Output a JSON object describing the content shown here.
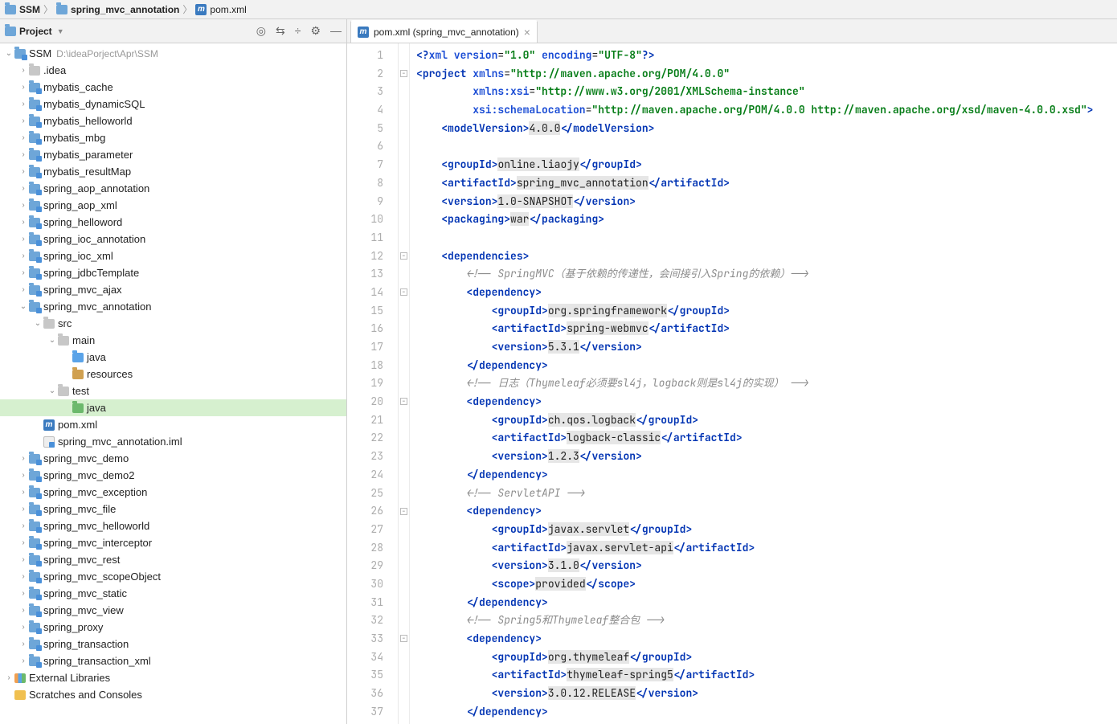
{
  "breadcrumb": {
    "root": "SSM",
    "module": "spring_mvc_annotation",
    "file": "pom.xml"
  },
  "sidebar": {
    "title": "Project",
    "rootName": "SSM",
    "rootPath": "D:\\ideaPorject\\Apr\\SSM",
    "extLib": "External Libraries",
    "scratch": "Scratches and Consoles",
    "nodes": [
      {
        "d": 1,
        "tw": ">",
        "icon": "dir",
        "label": ".idea"
      },
      {
        "d": 1,
        "tw": ">",
        "icon": "mod",
        "label": "mybatis_cache"
      },
      {
        "d": 1,
        "tw": ">",
        "icon": "mod",
        "label": "mybatis_dynamicSQL"
      },
      {
        "d": 1,
        "tw": ">",
        "icon": "mod",
        "label": "mybatis_helloworld"
      },
      {
        "d": 1,
        "tw": ">",
        "icon": "mod",
        "label": "mybatis_mbg"
      },
      {
        "d": 1,
        "tw": ">",
        "icon": "mod",
        "label": "mybatis_parameter"
      },
      {
        "d": 1,
        "tw": ">",
        "icon": "mod",
        "label": "mybatis_resultMap"
      },
      {
        "d": 1,
        "tw": ">",
        "icon": "mod",
        "label": "spring_aop_annotation"
      },
      {
        "d": 1,
        "tw": ">",
        "icon": "mod",
        "label": "spring_aop_xml"
      },
      {
        "d": 1,
        "tw": ">",
        "icon": "mod",
        "label": "spring_helloword"
      },
      {
        "d": 1,
        "tw": ">",
        "icon": "mod",
        "label": "spring_ioc_annotation"
      },
      {
        "d": 1,
        "tw": ">",
        "icon": "mod",
        "label": "spring_ioc_xml"
      },
      {
        "d": 1,
        "tw": ">",
        "icon": "mod",
        "label": "spring_jdbcTemplate"
      },
      {
        "d": 1,
        "tw": ">",
        "icon": "mod",
        "label": "spring_mvc_ajax"
      },
      {
        "d": 1,
        "tw": "v",
        "icon": "mod",
        "label": "spring_mvc_annotation"
      },
      {
        "d": 2,
        "tw": "v",
        "icon": "dir",
        "label": "src"
      },
      {
        "d": 3,
        "tw": "v",
        "icon": "dir",
        "label": "main"
      },
      {
        "d": 4,
        "tw": "",
        "icon": "src",
        "label": "java"
      },
      {
        "d": 4,
        "tw": "",
        "icon": "res",
        "label": "resources"
      },
      {
        "d": 3,
        "tw": "v",
        "icon": "dir",
        "label": "test"
      },
      {
        "d": 4,
        "tw": "",
        "icon": "test",
        "label": "java",
        "sel": true
      },
      {
        "d": 2,
        "tw": "",
        "icon": "m",
        "label": "pom.xml"
      },
      {
        "d": 2,
        "tw": "",
        "icon": "iml",
        "label": "spring_mvc_annotation.iml"
      },
      {
        "d": 1,
        "tw": ">",
        "icon": "mod",
        "label": "spring_mvc_demo"
      },
      {
        "d": 1,
        "tw": ">",
        "icon": "mod",
        "label": "spring_mvc_demo2"
      },
      {
        "d": 1,
        "tw": ">",
        "icon": "mod",
        "label": "spring_mvc_exception"
      },
      {
        "d": 1,
        "tw": ">",
        "icon": "mod",
        "label": "spring_mvc_file"
      },
      {
        "d": 1,
        "tw": ">",
        "icon": "mod",
        "label": "spring_mvc_helloworld"
      },
      {
        "d": 1,
        "tw": ">",
        "icon": "mod",
        "label": "spring_mvc_interceptor"
      },
      {
        "d": 1,
        "tw": ">",
        "icon": "mod",
        "label": "spring_mvc_rest"
      },
      {
        "d": 1,
        "tw": ">",
        "icon": "mod",
        "label": "spring_mvc_scopeObject"
      },
      {
        "d": 1,
        "tw": ">",
        "icon": "mod",
        "label": "spring_mvc_static"
      },
      {
        "d": 1,
        "tw": ">",
        "icon": "mod",
        "label": "spring_mvc_view"
      },
      {
        "d": 1,
        "tw": ">",
        "icon": "mod",
        "label": "spring_proxy"
      },
      {
        "d": 1,
        "tw": ">",
        "icon": "mod",
        "label": "spring_transaction"
      },
      {
        "d": 1,
        "tw": ">",
        "icon": "mod",
        "label": "spring_transaction_xml"
      }
    ]
  },
  "tab": {
    "label": "pom.xml (spring_mvc_annotation)"
  },
  "code": {
    "lineCount": 37,
    "foldMarks": [
      {
        "line": 2,
        "sym": "−"
      },
      {
        "line": 12,
        "sym": "−"
      },
      {
        "line": 14,
        "sym": "−"
      },
      {
        "line": 20,
        "sym": "−"
      },
      {
        "line": 26,
        "sym": "−"
      },
      {
        "line": 33,
        "sym": "−"
      }
    ],
    "lines": [
      [
        {
          "t": "<?",
          "c": "tag"
        },
        {
          "t": "xml version",
          "c": "attr"
        },
        {
          "t": "=",
          "c": "txt"
        },
        {
          "t": "\"1.0\"",
          "c": "str"
        },
        {
          "t": " ",
          "c": "txt"
        },
        {
          "t": "encoding",
          "c": "attr"
        },
        {
          "t": "=",
          "c": "txt"
        },
        {
          "t": "\"UTF-8\"",
          "c": "str"
        },
        {
          "t": "?>",
          "c": "tag"
        }
      ],
      [
        {
          "t": "<",
          "c": "tag"
        },
        {
          "t": "project ",
          "c": "tag"
        },
        {
          "t": "xmlns",
          "c": "attr"
        },
        {
          "t": "=",
          "c": "txt"
        },
        {
          "t": "\"http://maven.apache.org/POM/4.0.0\"",
          "c": "str"
        }
      ],
      [
        {
          "t": "         ",
          "c": "txt"
        },
        {
          "t": "xmlns:xsi",
          "c": "attr"
        },
        {
          "t": "=",
          "c": "txt"
        },
        {
          "t": "\"http://www.w3.org/2001/XMLSchema-instance\"",
          "c": "str"
        }
      ],
      [
        {
          "t": "         ",
          "c": "txt"
        },
        {
          "t": "xsi:schemaLocation",
          "c": "attr"
        },
        {
          "t": "=",
          "c": "txt"
        },
        {
          "t": "\"http://maven.apache.org/POM/4.0.0 http://maven.apache.org/xsd/maven-4.0.0.xsd\"",
          "c": "str"
        },
        {
          "t": ">",
          "c": "tag"
        }
      ],
      [
        {
          "t": "    <",
          "c": "tag"
        },
        {
          "t": "modelVersion",
          "c": "tag"
        },
        {
          "t": ">",
          "c": "tag"
        },
        {
          "t": "4.0.0",
          "c": "txt hl"
        },
        {
          "t": "</",
          "c": "tag"
        },
        {
          "t": "modelVersion",
          "c": "tag"
        },
        {
          "t": ">",
          "c": "tag"
        }
      ],
      [],
      [
        {
          "t": "    <",
          "c": "tag"
        },
        {
          "t": "groupId",
          "c": "tag"
        },
        {
          "t": ">",
          "c": "tag"
        },
        {
          "t": "online.liaojy",
          "c": "txt hl"
        },
        {
          "t": "</",
          "c": "tag"
        },
        {
          "t": "groupId",
          "c": "tag"
        },
        {
          "t": ">",
          "c": "tag"
        }
      ],
      [
        {
          "t": "    <",
          "c": "tag"
        },
        {
          "t": "artifactId",
          "c": "tag"
        },
        {
          "t": ">",
          "c": "tag"
        },
        {
          "t": "spring_mvc_annotation",
          "c": "txt hl"
        },
        {
          "t": "</",
          "c": "tag"
        },
        {
          "t": "artifactId",
          "c": "tag"
        },
        {
          "t": ">",
          "c": "tag"
        }
      ],
      [
        {
          "t": "    <",
          "c": "tag"
        },
        {
          "t": "version",
          "c": "tag"
        },
        {
          "t": ">",
          "c": "tag"
        },
        {
          "t": "1.0-SNAPSHOT",
          "c": "txt hl"
        },
        {
          "t": "</",
          "c": "tag"
        },
        {
          "t": "version",
          "c": "tag"
        },
        {
          "t": ">",
          "c": "tag"
        }
      ],
      [
        {
          "t": "    <",
          "c": "tag"
        },
        {
          "t": "packaging",
          "c": "tag"
        },
        {
          "t": ">",
          "c": "tag"
        },
        {
          "t": "war",
          "c": "txt hl"
        },
        {
          "t": "</",
          "c": "tag"
        },
        {
          "t": "packaging",
          "c": "tag"
        },
        {
          "t": ">",
          "c": "tag"
        }
      ],
      [],
      [
        {
          "t": "    <",
          "c": "tag"
        },
        {
          "t": "dependencies",
          "c": "tag"
        },
        {
          "t": ">",
          "c": "tag"
        }
      ],
      [
        {
          "t": "        ",
          "c": "txt"
        },
        {
          "t": "<!-- SpringMVC（基于依赖的传递性，会间接引入Spring的依赖）-->",
          "c": "cmt"
        }
      ],
      [
        {
          "t": "        <",
          "c": "tag"
        },
        {
          "t": "dependency",
          "c": "tag"
        },
        {
          "t": ">",
          "c": "tag"
        }
      ],
      [
        {
          "t": "            <",
          "c": "tag"
        },
        {
          "t": "groupId",
          "c": "tag"
        },
        {
          "t": ">",
          "c": "tag"
        },
        {
          "t": "org.springframework",
          "c": "txt hl"
        },
        {
          "t": "</",
          "c": "tag"
        },
        {
          "t": "groupId",
          "c": "tag"
        },
        {
          "t": ">",
          "c": "tag"
        }
      ],
      [
        {
          "t": "            <",
          "c": "tag"
        },
        {
          "t": "artifactId",
          "c": "tag"
        },
        {
          "t": ">",
          "c": "tag"
        },
        {
          "t": "spring-webmvc",
          "c": "txt hl"
        },
        {
          "t": "</",
          "c": "tag"
        },
        {
          "t": "artifactId",
          "c": "tag"
        },
        {
          "t": ">",
          "c": "tag"
        }
      ],
      [
        {
          "t": "            <",
          "c": "tag"
        },
        {
          "t": "version",
          "c": "tag"
        },
        {
          "t": ">",
          "c": "tag"
        },
        {
          "t": "5.3.1",
          "c": "txt hl"
        },
        {
          "t": "</",
          "c": "tag"
        },
        {
          "t": "version",
          "c": "tag"
        },
        {
          "t": ">",
          "c": "tag"
        }
      ],
      [
        {
          "t": "        </",
          "c": "tag"
        },
        {
          "t": "dependency",
          "c": "tag"
        },
        {
          "t": ">",
          "c": "tag"
        }
      ],
      [
        {
          "t": "        ",
          "c": "txt"
        },
        {
          "t": "<!-- 日志（Thymeleaf必须要sl4j，logback则是sl4j的实现） -->",
          "c": "cmt"
        }
      ],
      [
        {
          "t": "        <",
          "c": "tag"
        },
        {
          "t": "dependency",
          "c": "tag"
        },
        {
          "t": ">",
          "c": "tag"
        }
      ],
      [
        {
          "t": "            <",
          "c": "tag"
        },
        {
          "t": "groupId",
          "c": "tag"
        },
        {
          "t": ">",
          "c": "tag"
        },
        {
          "t": "ch.qos.logback",
          "c": "txt hl"
        },
        {
          "t": "</",
          "c": "tag"
        },
        {
          "t": "groupId",
          "c": "tag"
        },
        {
          "t": ">",
          "c": "tag"
        }
      ],
      [
        {
          "t": "            <",
          "c": "tag"
        },
        {
          "t": "artifactId",
          "c": "tag"
        },
        {
          "t": ">",
          "c": "tag"
        },
        {
          "t": "logback-classic",
          "c": "txt hl"
        },
        {
          "t": "</",
          "c": "tag"
        },
        {
          "t": "artifactId",
          "c": "tag"
        },
        {
          "t": ">",
          "c": "tag"
        }
      ],
      [
        {
          "t": "            <",
          "c": "tag"
        },
        {
          "t": "version",
          "c": "tag"
        },
        {
          "t": ">",
          "c": "tag"
        },
        {
          "t": "1.2.3",
          "c": "txt hl"
        },
        {
          "t": "</",
          "c": "tag"
        },
        {
          "t": "version",
          "c": "tag"
        },
        {
          "t": ">",
          "c": "tag"
        }
      ],
      [
        {
          "t": "        </",
          "c": "tag"
        },
        {
          "t": "dependency",
          "c": "tag"
        },
        {
          "t": ">",
          "c": "tag"
        }
      ],
      [
        {
          "t": "        ",
          "c": "txt"
        },
        {
          "t": "<!-- ServletAPI -->",
          "c": "cmt"
        }
      ],
      [
        {
          "t": "        <",
          "c": "tag"
        },
        {
          "t": "dependency",
          "c": "tag"
        },
        {
          "t": ">",
          "c": "tag"
        }
      ],
      [
        {
          "t": "            <",
          "c": "tag"
        },
        {
          "t": "groupId",
          "c": "tag"
        },
        {
          "t": ">",
          "c": "tag"
        },
        {
          "t": "javax.servlet",
          "c": "txt hl"
        },
        {
          "t": "</",
          "c": "tag"
        },
        {
          "t": "groupId",
          "c": "tag"
        },
        {
          "t": ">",
          "c": "tag"
        }
      ],
      [
        {
          "t": "            <",
          "c": "tag"
        },
        {
          "t": "artifactId",
          "c": "tag"
        },
        {
          "t": ">",
          "c": "tag"
        },
        {
          "t": "javax.servlet-api",
          "c": "txt hl"
        },
        {
          "t": "</",
          "c": "tag"
        },
        {
          "t": "artifactId",
          "c": "tag"
        },
        {
          "t": ">",
          "c": "tag"
        }
      ],
      [
        {
          "t": "            <",
          "c": "tag"
        },
        {
          "t": "version",
          "c": "tag"
        },
        {
          "t": ">",
          "c": "tag"
        },
        {
          "t": "3.1.0",
          "c": "txt hl"
        },
        {
          "t": "</",
          "c": "tag"
        },
        {
          "t": "version",
          "c": "tag"
        },
        {
          "t": ">",
          "c": "tag"
        }
      ],
      [
        {
          "t": "            <",
          "c": "tag"
        },
        {
          "t": "scope",
          "c": "tag"
        },
        {
          "t": ">",
          "c": "tag"
        },
        {
          "t": "provided",
          "c": "txt hl"
        },
        {
          "t": "</",
          "c": "tag"
        },
        {
          "t": "scope",
          "c": "tag"
        },
        {
          "t": ">",
          "c": "tag"
        }
      ],
      [
        {
          "t": "        </",
          "c": "tag"
        },
        {
          "t": "dependency",
          "c": "tag"
        },
        {
          "t": ">",
          "c": "tag"
        }
      ],
      [
        {
          "t": "        ",
          "c": "txt"
        },
        {
          "t": "<!-- Spring5和Thymeleaf整合包 -->",
          "c": "cmt"
        }
      ],
      [
        {
          "t": "        <",
          "c": "tag"
        },
        {
          "t": "dependency",
          "c": "tag"
        },
        {
          "t": ">",
          "c": "tag"
        }
      ],
      [
        {
          "t": "            <",
          "c": "tag"
        },
        {
          "t": "groupId",
          "c": "tag"
        },
        {
          "t": ">",
          "c": "tag"
        },
        {
          "t": "org.thymeleaf",
          "c": "txt hl"
        },
        {
          "t": "</",
          "c": "tag"
        },
        {
          "t": "groupId",
          "c": "tag"
        },
        {
          "t": ">",
          "c": "tag"
        }
      ],
      [
        {
          "t": "            <",
          "c": "tag"
        },
        {
          "t": "artifactId",
          "c": "tag"
        },
        {
          "t": ">",
          "c": "tag"
        },
        {
          "t": "thymeleaf-spring5",
          "c": "txt hl"
        },
        {
          "t": "</",
          "c": "tag"
        },
        {
          "t": "artifactId",
          "c": "tag"
        },
        {
          "t": ">",
          "c": "tag"
        }
      ],
      [
        {
          "t": "            <",
          "c": "tag"
        },
        {
          "t": "version",
          "c": "tag"
        },
        {
          "t": ">",
          "c": "tag"
        },
        {
          "t": "3.0.12.RELEASE",
          "c": "txt hl"
        },
        {
          "t": "</",
          "c": "tag"
        },
        {
          "t": "version",
          "c": "tag"
        },
        {
          "t": ">",
          "c": "tag"
        }
      ],
      [
        {
          "t": "        </",
          "c": "tag"
        },
        {
          "t": "dependency",
          "c": "tag"
        },
        {
          "t": ">",
          "c": "tag"
        }
      ]
    ],
    "lineIndents": [
      0,
      0,
      0,
      0,
      0,
      0,
      0,
      0,
      0,
      0,
      0,
      0,
      0,
      0,
      0,
      0,
      0,
      0,
      0,
      0,
      0,
      0,
      0,
      0,
      0,
      0,
      0,
      0,
      0,
      0,
      0,
      0,
      0,
      0,
      0,
      0,
      0
    ]
  }
}
